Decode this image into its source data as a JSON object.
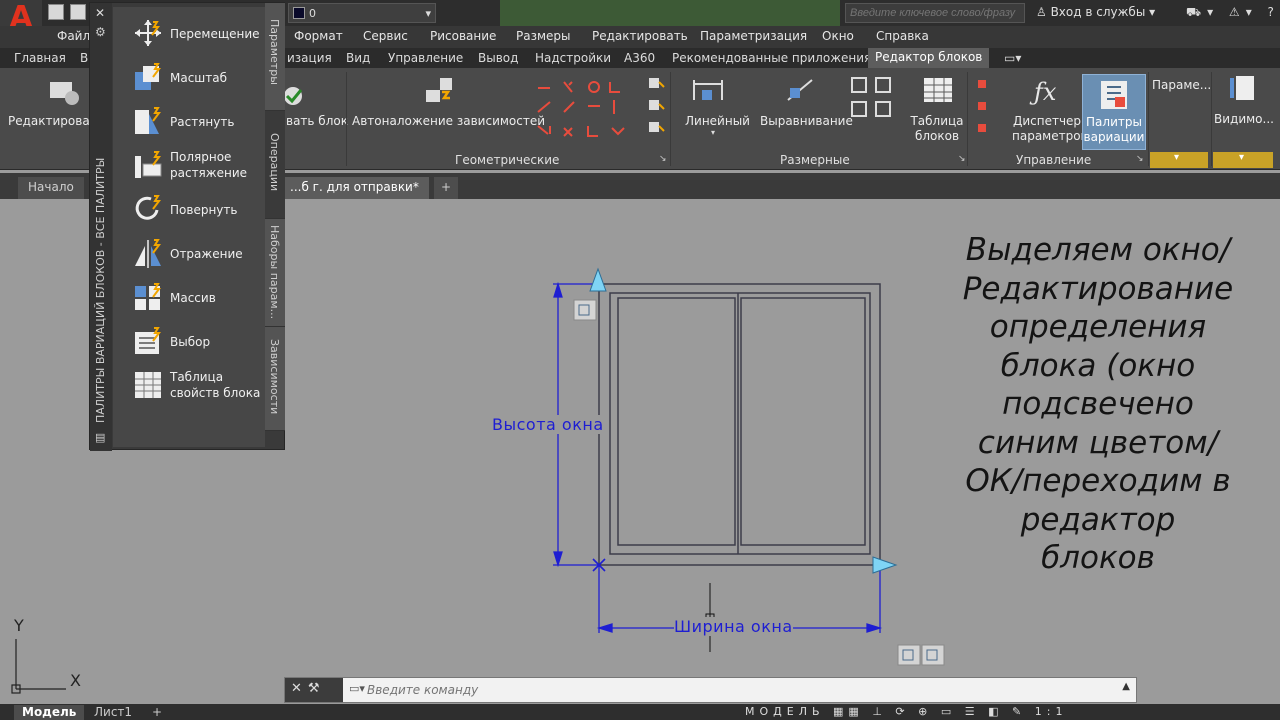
{
  "app": {
    "logo_letter": "A",
    "accent_color": "#e0321e"
  },
  "titlebar": {
    "layer_value": "0",
    "search_placeholder": "Введите ключевое слово/фразу",
    "signin_label": "Вход в службы"
  },
  "menu": [
    "Файл",
    "Формат",
    "Сервис",
    "Рисование",
    "Размеры",
    "Редактировать",
    "Параметризация",
    "Окно",
    "Справка"
  ],
  "ribbon_tabs": [
    "Главная",
    "В",
    "изация",
    "Вид",
    "Управление",
    "Вывод",
    "Надстройки",
    "A360",
    "Рекомендованные приложения",
    "Редактор блоков"
  ],
  "ribbon": {
    "edit_label": "Редактироват",
    "save_label": "вать блок",
    "autoconstrain_label": "Автоналожение зависимостей",
    "linear_label": "Линейный",
    "aligned_label": "Выравнивание",
    "table_label": "Таблица блоков",
    "param_manager_label": "Диспетчер параметров",
    "palettes_label": "Палитры вариации",
    "params_label": "Параме...",
    "visibility_label": "Видимо...",
    "panel_geometric": "Геометрические",
    "panel_dimensional": "Размерные",
    "panel_manage": "Управление"
  },
  "filetabs": {
    "start": "Начало",
    "drawing": "...б г. для отправки*",
    "add": "+"
  },
  "palette": {
    "vertical_title": "ПАЛИТРЫ ВАРИАЦИЙ БЛОКОВ - ВСЕ ПАЛИТРЫ",
    "close": "✕",
    "items": [
      {
        "label": "Перемещение",
        "icon": "move-icon"
      },
      {
        "label": "Масштаб",
        "icon": "scale-icon"
      },
      {
        "label": "Растянуть",
        "icon": "stretch-icon"
      },
      {
        "label": "Полярное растяжение",
        "icon": "polar-stretch-icon"
      },
      {
        "label": "Повернуть",
        "icon": "rotate-icon"
      },
      {
        "label": "Отражение",
        "icon": "flip-icon"
      },
      {
        "label": "Массив",
        "icon": "array-icon"
      },
      {
        "label": "Выбор",
        "icon": "lookup-icon"
      },
      {
        "label": "Таблица свойств блока",
        "icon": "properties-table-icon"
      }
    ],
    "side_tabs": [
      "Параметры",
      "Операции",
      "Наборы парам...",
      "Зависимости"
    ]
  },
  "drawing": {
    "height_label": "Высота  окна",
    "width_label": "Ширина  окна",
    "dimension_color": "#1e1ed2",
    "grip_color": "#7fd4f5"
  },
  "note": {
    "text_lines": [
      "Выделяем окно/",
      "Редактирование",
      "определения",
      "блока (окно",
      "подсвечено",
      "синим цветом/",
      "ОК/переходим в",
      "редактор",
      "блоков"
    ]
  },
  "ucs": {
    "y": "Y",
    "x": "X"
  },
  "command": {
    "placeholder": "Введите команду"
  },
  "status": {
    "model_tab": "Модель",
    "layout_tab": "Лист1",
    "add": "+",
    "mode": "МОДЕЛЬ",
    "scale": "1:1"
  }
}
